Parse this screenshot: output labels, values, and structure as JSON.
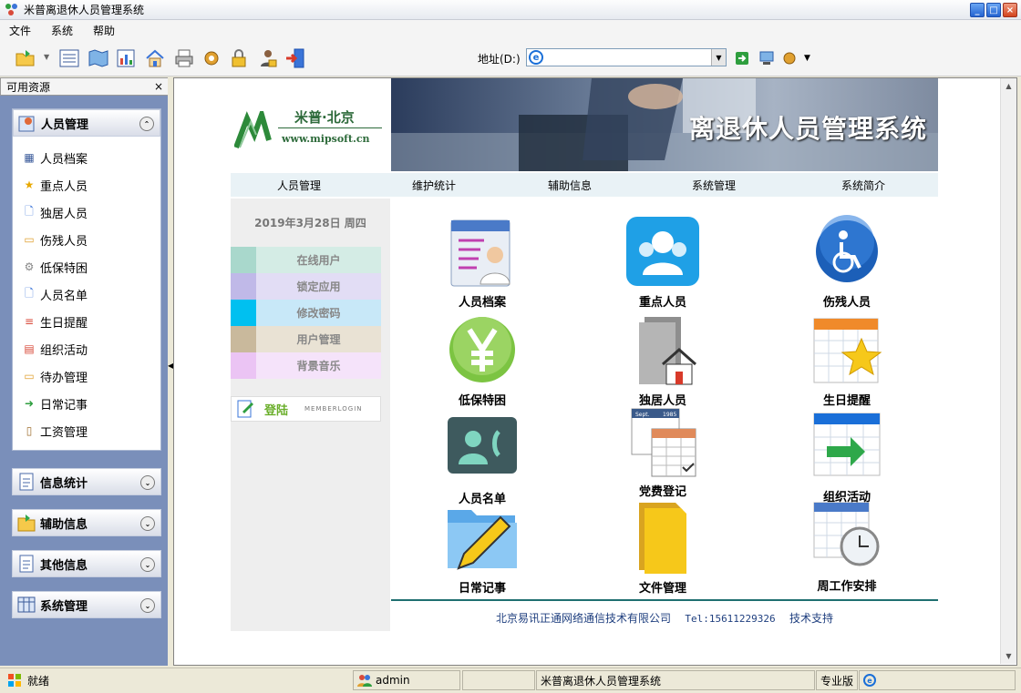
{
  "window": {
    "title": "米普离退休人员管理系统"
  },
  "menu": {
    "items": [
      "文件",
      "系统",
      "帮助"
    ]
  },
  "address": {
    "label": "地址(D:)",
    "value": ""
  },
  "sidebar": {
    "title": "可用资源",
    "close": "×",
    "groups": [
      {
        "label": "人员管理",
        "expanded": true,
        "items": [
          "人员档案",
          "重点人员",
          "独居人员",
          "伤残人员",
          "低保特困",
          "人员名单",
          "生日提醒",
          "组织活动",
          "待办管理",
          "日常记事",
          "工资管理"
        ]
      },
      {
        "label": "信息统计",
        "expanded": false
      },
      {
        "label": "辅助信息",
        "expanded": false
      },
      {
        "label": "其他信息",
        "expanded": false
      },
      {
        "label": "系统管理",
        "expanded": false
      }
    ]
  },
  "header": {
    "logo_brand": "米普·北京",
    "logo_url": "www.mipsoft.cn",
    "banner_title": "离退休人员管理系统"
  },
  "topnav": [
    "人员管理",
    "维护统计",
    "辅助信息",
    "系统管理",
    "系统简介"
  ],
  "leftcol": {
    "date": "2019年3月28日  周四",
    "quick": [
      {
        "label": "在线用户",
        "swatch": "#a9d8cc",
        "bg": "#d4ece5"
      },
      {
        "label": "锁定应用",
        "swatch": "#c0b9e8",
        "bg": "#e2ddf5"
      },
      {
        "label": "修改密码",
        "swatch": "#00c0f0",
        "bg": "#c8e8f8"
      },
      {
        "label": "用户管理",
        "swatch": "#c9b99c",
        "bg": "#e9e2d4"
      },
      {
        "label": "背景音乐",
        "swatch": "#ebc4f4",
        "bg": "#f5e3fa"
      }
    ],
    "login_label": "登陆",
    "login_sub": "MEMBERLOGIN"
  },
  "tiles": [
    {
      "label": "人员档案",
      "icon": "person-file-icon"
    },
    {
      "label": "重点人员",
      "icon": "key-people-icon"
    },
    {
      "label": "伤残人员",
      "icon": "wheelchair-icon"
    },
    {
      "label": "低保特困",
      "icon": "yen-icon"
    },
    {
      "label": "独居人员",
      "icon": "house-folder-icon"
    },
    {
      "label": "生日提醒",
      "icon": "star-calendar-icon"
    },
    {
      "label": "人员名单",
      "icon": "contact-phone-icon"
    },
    {
      "label": "党费登记",
      "icon": "calendar-list-icon"
    },
    {
      "label": "组织活动",
      "icon": "calendar-arrow-icon"
    },
    {
      "label": "日常记事",
      "icon": "folder-pencil-icon"
    },
    {
      "label": "文件管理",
      "icon": "folder-icon"
    },
    {
      "label": "周工作安排",
      "icon": "calendar-clock-icon"
    }
  ],
  "tile_text": {
    "calendar_month": "Sept.",
    "calendar_year": "1985"
  },
  "footer": {
    "company": "北京易讯正通网络通信技术有限公司",
    "tel": "Tel:15611229326",
    "support": "技术支持"
  },
  "status": {
    "ready": "就绪",
    "user": "admin",
    "app": "米普离退休人员管理系统",
    "edition": "专业版"
  }
}
